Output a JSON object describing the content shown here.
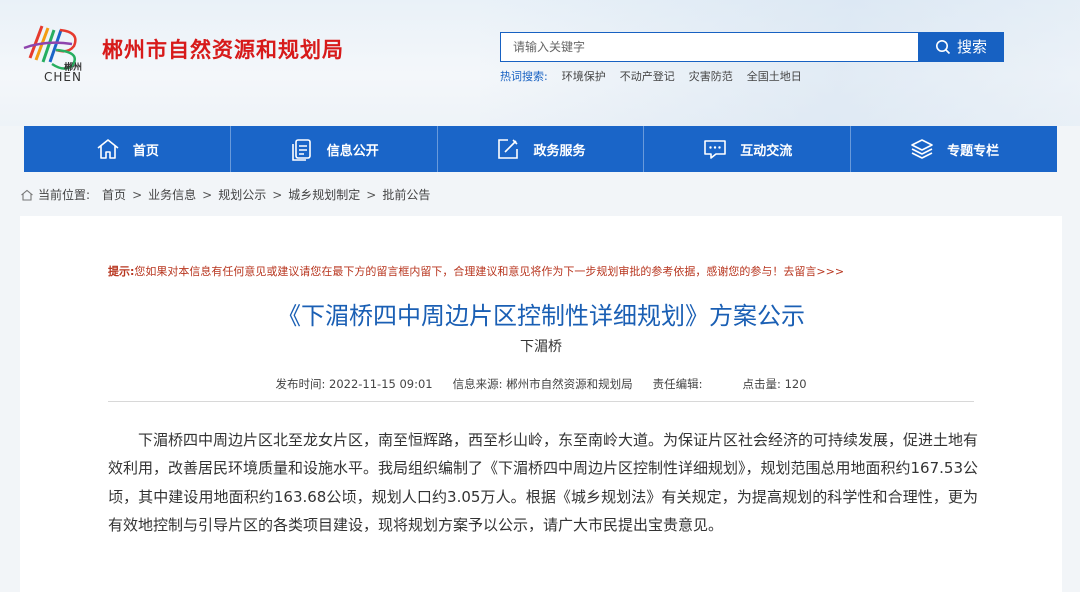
{
  "header": {
    "logo_text_top": "郴州",
    "logo_text_bottom": "CHEN",
    "site_title": "郴州市自然资源和规划局"
  },
  "search": {
    "placeholder": "请输入关键字",
    "button_label": "搜索",
    "hot_label": "热词搜索:",
    "hot_words": [
      "环境保护",
      "不动产登记",
      "灾害防范",
      "全国土地日"
    ]
  },
  "nav": {
    "items": [
      {
        "label": "首页",
        "icon": "home-icon"
      },
      {
        "label": "信息公开",
        "icon": "document-icon"
      },
      {
        "label": "政务服务",
        "icon": "edit-icon"
      },
      {
        "label": "互动交流",
        "icon": "chat-icon"
      },
      {
        "label": "专题专栏",
        "icon": "layers-icon"
      }
    ]
  },
  "breadcrumb": {
    "prefix": "当前位置:",
    "items": [
      "首页",
      "业务信息",
      "规划公示",
      "城乡规划制定",
      "批前公告"
    ]
  },
  "article": {
    "tip_label": "提示:",
    "tip_text": "您如果对本信息有任何意见或建议请您在最下方的留言框内留下，合理建议和意见将作为下一步规划审批的参考依据，感谢您的参与！去留言>>>",
    "title": "《下湄桥四中周边片区控制性详细规划》方案公示",
    "subtitle": "下湄桥",
    "publish_time": "发布时间: 2022-11-15 09:01",
    "source": "信息来源: 郴州市自然资源和规划局",
    "editor": "责任编辑:",
    "clicks": "点击量: 120",
    "body": "下湄桥四中周边片区北至龙女片区，南至恒辉路，西至杉山岭，东至南岭大道。为保证片区社会经济的可持续发展，促进土地有效利用，改善居民环境质量和设施水平。我局组织编制了《下湄桥四中周边片区控制性详细规划》，规划范围总用地面积约167.53公顷，其中建设用地面积约163.68公顷，规划人口约3.05万人。根据《城乡规划法》有关规定，为提高规划的科学性和合理性，更为有效地控制与引导片区的各类项目建设，现将规划方案予以公示，请广大市民提出宝贵意见。"
  },
  "colors": {
    "brand_blue": "#1a65c8",
    "title_red": "#d71a1a",
    "title_blue": "#1a5fb4",
    "tip_red": "#b8361f"
  }
}
